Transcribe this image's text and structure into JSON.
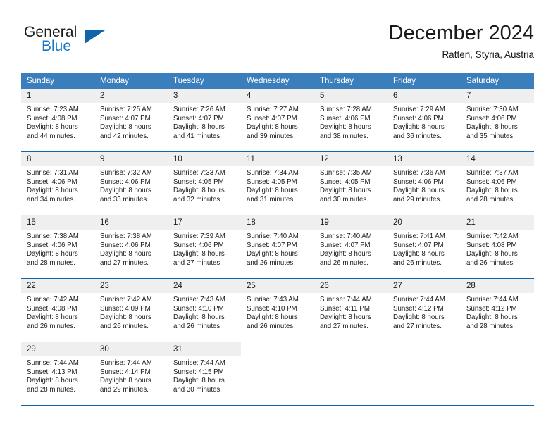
{
  "logo": {
    "text_general": "General",
    "text_blue": "Blue",
    "triangle_color": "#1464aa",
    "blue_color": "#1878c8"
  },
  "header": {
    "title": "December 2024",
    "subtitle": "Ratten, Styria, Austria"
  },
  "theme": {
    "header_bg": "#3b7ebc",
    "rule_color": "#1464aa",
    "daynum_bg": "#efefef",
    "text_color": "#1a1a1a"
  },
  "weekday_headers": [
    "Sunday",
    "Monday",
    "Tuesday",
    "Wednesday",
    "Thursday",
    "Friday",
    "Saturday"
  ],
  "weeks": [
    [
      {
        "day": "1",
        "sunrise": "Sunrise: 7:23 AM",
        "sunset": "Sunset: 4:08 PM",
        "daylight1": "Daylight: 8 hours",
        "daylight2": "and 44 minutes."
      },
      {
        "day": "2",
        "sunrise": "Sunrise: 7:25 AM",
        "sunset": "Sunset: 4:07 PM",
        "daylight1": "Daylight: 8 hours",
        "daylight2": "and 42 minutes."
      },
      {
        "day": "3",
        "sunrise": "Sunrise: 7:26 AM",
        "sunset": "Sunset: 4:07 PM",
        "daylight1": "Daylight: 8 hours",
        "daylight2": "and 41 minutes."
      },
      {
        "day": "4",
        "sunrise": "Sunrise: 7:27 AM",
        "sunset": "Sunset: 4:07 PM",
        "daylight1": "Daylight: 8 hours",
        "daylight2": "and 39 minutes."
      },
      {
        "day": "5",
        "sunrise": "Sunrise: 7:28 AM",
        "sunset": "Sunset: 4:06 PM",
        "daylight1": "Daylight: 8 hours",
        "daylight2": "and 38 minutes."
      },
      {
        "day": "6",
        "sunrise": "Sunrise: 7:29 AM",
        "sunset": "Sunset: 4:06 PM",
        "daylight1": "Daylight: 8 hours",
        "daylight2": "and 36 minutes."
      },
      {
        "day": "7",
        "sunrise": "Sunrise: 7:30 AM",
        "sunset": "Sunset: 4:06 PM",
        "daylight1": "Daylight: 8 hours",
        "daylight2": "and 35 minutes."
      }
    ],
    [
      {
        "day": "8",
        "sunrise": "Sunrise: 7:31 AM",
        "sunset": "Sunset: 4:06 PM",
        "daylight1": "Daylight: 8 hours",
        "daylight2": "and 34 minutes."
      },
      {
        "day": "9",
        "sunrise": "Sunrise: 7:32 AM",
        "sunset": "Sunset: 4:06 PM",
        "daylight1": "Daylight: 8 hours",
        "daylight2": "and 33 minutes."
      },
      {
        "day": "10",
        "sunrise": "Sunrise: 7:33 AM",
        "sunset": "Sunset: 4:05 PM",
        "daylight1": "Daylight: 8 hours",
        "daylight2": "and 32 minutes."
      },
      {
        "day": "11",
        "sunrise": "Sunrise: 7:34 AM",
        "sunset": "Sunset: 4:05 PM",
        "daylight1": "Daylight: 8 hours",
        "daylight2": "and 31 minutes."
      },
      {
        "day": "12",
        "sunrise": "Sunrise: 7:35 AM",
        "sunset": "Sunset: 4:05 PM",
        "daylight1": "Daylight: 8 hours",
        "daylight2": "and 30 minutes."
      },
      {
        "day": "13",
        "sunrise": "Sunrise: 7:36 AM",
        "sunset": "Sunset: 4:06 PM",
        "daylight1": "Daylight: 8 hours",
        "daylight2": "and 29 minutes."
      },
      {
        "day": "14",
        "sunrise": "Sunrise: 7:37 AM",
        "sunset": "Sunset: 4:06 PM",
        "daylight1": "Daylight: 8 hours",
        "daylight2": "and 28 minutes."
      }
    ],
    [
      {
        "day": "15",
        "sunrise": "Sunrise: 7:38 AM",
        "sunset": "Sunset: 4:06 PM",
        "daylight1": "Daylight: 8 hours",
        "daylight2": "and 28 minutes."
      },
      {
        "day": "16",
        "sunrise": "Sunrise: 7:38 AM",
        "sunset": "Sunset: 4:06 PM",
        "daylight1": "Daylight: 8 hours",
        "daylight2": "and 27 minutes."
      },
      {
        "day": "17",
        "sunrise": "Sunrise: 7:39 AM",
        "sunset": "Sunset: 4:06 PM",
        "daylight1": "Daylight: 8 hours",
        "daylight2": "and 27 minutes."
      },
      {
        "day": "18",
        "sunrise": "Sunrise: 7:40 AM",
        "sunset": "Sunset: 4:07 PM",
        "daylight1": "Daylight: 8 hours",
        "daylight2": "and 26 minutes."
      },
      {
        "day": "19",
        "sunrise": "Sunrise: 7:40 AM",
        "sunset": "Sunset: 4:07 PM",
        "daylight1": "Daylight: 8 hours",
        "daylight2": "and 26 minutes."
      },
      {
        "day": "20",
        "sunrise": "Sunrise: 7:41 AM",
        "sunset": "Sunset: 4:07 PM",
        "daylight1": "Daylight: 8 hours",
        "daylight2": "and 26 minutes."
      },
      {
        "day": "21",
        "sunrise": "Sunrise: 7:42 AM",
        "sunset": "Sunset: 4:08 PM",
        "daylight1": "Daylight: 8 hours",
        "daylight2": "and 26 minutes."
      }
    ],
    [
      {
        "day": "22",
        "sunrise": "Sunrise: 7:42 AM",
        "sunset": "Sunset: 4:08 PM",
        "daylight1": "Daylight: 8 hours",
        "daylight2": "and 26 minutes."
      },
      {
        "day": "23",
        "sunrise": "Sunrise: 7:42 AM",
        "sunset": "Sunset: 4:09 PM",
        "daylight1": "Daylight: 8 hours",
        "daylight2": "and 26 minutes."
      },
      {
        "day": "24",
        "sunrise": "Sunrise: 7:43 AM",
        "sunset": "Sunset: 4:10 PM",
        "daylight1": "Daylight: 8 hours",
        "daylight2": "and 26 minutes."
      },
      {
        "day": "25",
        "sunrise": "Sunrise: 7:43 AM",
        "sunset": "Sunset: 4:10 PM",
        "daylight1": "Daylight: 8 hours",
        "daylight2": "and 26 minutes."
      },
      {
        "day": "26",
        "sunrise": "Sunrise: 7:44 AM",
        "sunset": "Sunset: 4:11 PM",
        "daylight1": "Daylight: 8 hours",
        "daylight2": "and 27 minutes."
      },
      {
        "day": "27",
        "sunrise": "Sunrise: 7:44 AM",
        "sunset": "Sunset: 4:12 PM",
        "daylight1": "Daylight: 8 hours",
        "daylight2": "and 27 minutes."
      },
      {
        "day": "28",
        "sunrise": "Sunrise: 7:44 AM",
        "sunset": "Sunset: 4:12 PM",
        "daylight1": "Daylight: 8 hours",
        "daylight2": "and 28 minutes."
      }
    ],
    [
      {
        "day": "29",
        "sunrise": "Sunrise: 7:44 AM",
        "sunset": "Sunset: 4:13 PM",
        "daylight1": "Daylight: 8 hours",
        "daylight2": "and 28 minutes."
      },
      {
        "day": "30",
        "sunrise": "Sunrise: 7:44 AM",
        "sunset": "Sunset: 4:14 PM",
        "daylight1": "Daylight: 8 hours",
        "daylight2": "and 29 minutes."
      },
      {
        "day": "31",
        "sunrise": "Sunrise: 7:44 AM",
        "sunset": "Sunset: 4:15 PM",
        "daylight1": "Daylight: 8 hours",
        "daylight2": "and 30 minutes."
      },
      {
        "day": "",
        "sunrise": "",
        "sunset": "",
        "daylight1": "",
        "daylight2": ""
      },
      {
        "day": "",
        "sunrise": "",
        "sunset": "",
        "daylight1": "",
        "daylight2": ""
      },
      {
        "day": "",
        "sunrise": "",
        "sunset": "",
        "daylight1": "",
        "daylight2": ""
      },
      {
        "day": "",
        "sunrise": "",
        "sunset": "",
        "daylight1": "",
        "daylight2": ""
      }
    ]
  ]
}
